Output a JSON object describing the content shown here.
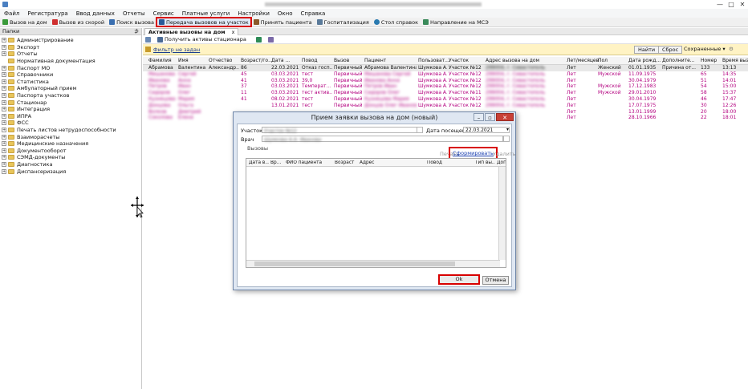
{
  "titlebar": {
    "controls": [
      "—",
      "□",
      "✕"
    ]
  },
  "menu": [
    "Файл",
    "Регистратура",
    "Ввод данных",
    "Отчеты",
    "Сервис",
    "Платные услуги",
    "Настройки",
    "Окно",
    "Справка"
  ],
  "toolbar": [
    {
      "label": "Вызов на дом",
      "icon": "house-call-icon",
      "color": "#3a9a3a"
    },
    {
      "label": "Вызов из скорой",
      "icon": "ambulance-icon",
      "color": "#d03030"
    },
    {
      "label": "Поиск вызова",
      "icon": "search-call-icon",
      "color": "#3a6fb0"
    },
    {
      "label": "Передача вызовов на участок",
      "icon": "transfer-icon",
      "color": "#2a5a9a"
    },
    {
      "label": "Принять пациента",
      "icon": "accept-patient-icon",
      "color": "#8a5a2a"
    },
    {
      "label": "Госпитализация",
      "icon": "hospital-icon",
      "color": "#5a7a9a"
    },
    {
      "label": "Стол справок",
      "icon": "help-desk-icon",
      "color": "#2a7ab0"
    },
    {
      "label": "Направление на МСЭ",
      "icon": "referral-icon",
      "color": "#3a8a5a"
    }
  ],
  "left_panel": {
    "title": "Папки",
    "pin": "⊅",
    "items": [
      {
        "label": "Администрирование",
        "expandable": true
      },
      {
        "label": "Экспорт",
        "expandable": true
      },
      {
        "label": "Отчеты",
        "expandable": true
      },
      {
        "label": "Нормативная документация",
        "expandable": false
      },
      {
        "label": "Паспорт МО",
        "expandable": true
      },
      {
        "label": "Справочники",
        "expandable": true
      },
      {
        "label": "Статистика",
        "expandable": true
      },
      {
        "label": "Амбулаторный прием",
        "expandable": true
      },
      {
        "label": "Паспорта участков",
        "expandable": true
      },
      {
        "label": "Стационар",
        "expandable": true
      },
      {
        "label": "Интеграция",
        "expandable": true
      },
      {
        "label": "ИПРА",
        "expandable": true
      },
      {
        "label": "ФСС",
        "expandable": true
      },
      {
        "label": "Печать листов нетрудоспособности",
        "expandable": true
      },
      {
        "label": "Взаиморасчеты",
        "expandable": true
      },
      {
        "label": "Медицинские назначения",
        "expandable": true
      },
      {
        "label": "Документооборот",
        "expandable": true
      },
      {
        "label": "СЭМД-документы",
        "expandable": true
      },
      {
        "label": "Диагностика",
        "expandable": true
      },
      {
        "label": "Диспансеризация",
        "expandable": true
      }
    ]
  },
  "main": {
    "tab": "Активные вызовы на дом",
    "tab_close": "x",
    "subtoolbar": {
      "get_assets": "Получить активы стационара"
    },
    "filter": {
      "text": "Фильтр не задан",
      "find": "Найти",
      "reset": "Сброс",
      "saved": "Сохраненные"
    },
    "columns": [
      "Фамилия",
      "Имя",
      "Отчество",
      "Возраст/го...",
      "Дата ...",
      "Повод",
      "Вызов",
      "Пациент",
      "Пользоват...",
      "Участок",
      "Адрес вызова на дом",
      "Лет/месяцев",
      "Пол",
      "Дата рожд...",
      "Дополните...",
      "Номер",
      "Время вызова"
    ],
    "rows": [
      {
        "fam": "Абрамова",
        "name": "Валентина",
        "otch": "Александр...",
        "age": "86",
        "date": "22.03.2021",
        "reason": "Отказ госп...",
        "call": "Первичный",
        "patient": "Абрамова Валентина",
        "user": "Шумкова А...",
        "uch": "Участок №12",
        "addr": "299004, г. Севастополь",
        "lm": "Лет",
        "sex": "Женский",
        "dob": "01.01.1935",
        "add": "Причина от...",
        "num": "133",
        "time": "13:13"
      },
      {
        "fam": "Мишанова",
        "name": "Сергей",
        "otch": "",
        "age": "45",
        "date": "03.03.2021",
        "reason": "тест",
        "call": "Первичный",
        "patient": "Мишанова Сергей",
        "user": "Шумкова А...",
        "uch": "Участок №12",
        "addr": "299004, г. Севастополь",
        "lm": "Лет",
        "sex": "Мужской",
        "dob": "11.09.1975",
        "add": "",
        "num": "65",
        "time": "14:35"
      },
      {
        "fam": "Иванова",
        "name": "Анна",
        "otch": "",
        "age": "41",
        "date": "03.03.2021",
        "reason": "39,0",
        "call": "Первичный",
        "patient": "Иванова Анна",
        "user": "Шумкова А...",
        "uch": "Участок №12",
        "addr": "299004, г. Севастополь",
        "lm": "Лет",
        "sex": "",
        "dob": "30.04.1979",
        "add": "",
        "num": "51",
        "time": "14:01"
      },
      {
        "fam": "Петров",
        "name": "Иван",
        "otch": "",
        "age": "37",
        "date": "03.03.2021",
        "reason": "Температ...",
        "call": "Первичный",
        "patient": "Петров Иван",
        "user": "Шумкова А...",
        "uch": "Участок №12",
        "addr": "299004, г. Севастополь",
        "lm": "Лет",
        "sex": "Мужской",
        "dob": "17.12.1983",
        "add": "",
        "num": "54",
        "time": "15:00"
      },
      {
        "fam": "Сидоров",
        "name": "Олег",
        "otch": "",
        "age": "11",
        "date": "03.03.2021",
        "reason": "тест актив...",
        "call": "Первичный",
        "patient": "Сидоров Олег",
        "user": "Шумкова А...",
        "uch": "Участок №11",
        "addr": "299004, г. Севастополь",
        "lm": "Лет",
        "sex": "Мужской",
        "dob": "29.01.2010",
        "add": "",
        "num": "58",
        "time": "15:37"
      },
      {
        "fam": "Кузнецова",
        "name": "Мария",
        "otch": "",
        "age": "41",
        "date": "08.02.2021",
        "reason": "тест",
        "call": "Первичный",
        "patient": "Кузнецова Мария",
        "user": "Шумкова А...",
        "uch": "Участок №12",
        "addr": "299004, г. Севастополь",
        "lm": "Лет",
        "sex": "",
        "dob": "30.04.1979",
        "add": "",
        "num": "46",
        "time": "17:47"
      },
      {
        "fam": "Донцова",
        "name": "Ольга",
        "otch": "",
        "age": "",
        "date": "13.01.2021",
        "reason": "тест",
        "call": "Первичный",
        "patient": "Донцов Олег Иванович",
        "user": "Шумкова А...",
        "uch": "Участок №12",
        "addr": "299004, г. Севастополь",
        "lm": "Лет",
        "sex": "",
        "dob": "17.07.1975",
        "add": "",
        "num": "30",
        "time": "12:26"
      },
      {
        "fam": "Волков",
        "name": "Дмитрий",
        "otch": "",
        "age": "",
        "date": "",
        "reason": "",
        "call": "",
        "patient": "",
        "user": "",
        "uch": "",
        "addr": "",
        "lm": "Лет",
        "sex": "",
        "dob": "13.01.1999",
        "add": "",
        "num": "20",
        "time": "18:00"
      },
      {
        "fam": "Соколова",
        "name": "Елена",
        "otch": "",
        "age": "",
        "date": "",
        "reason": "",
        "call": "",
        "patient": "",
        "user": "",
        "uch": "",
        "addr": "",
        "lm": "Лет",
        "sex": "",
        "dob": "28.10.1966",
        "add": "",
        "num": "22",
        "time": "18:01"
      }
    ]
  },
  "dialog": {
    "title": "Прием заявки вызова на дом (новый)",
    "uchastok_label": "Участок",
    "uchastok_value": "Участок №12",
    "date_label": "Дата посещения",
    "date_value": "22.03.2021",
    "doctor_label": "Врач",
    "doctor_value": "Шумкова А.А. Иванова",
    "calls_label": "Вызовы",
    "print": "Печать",
    "generate": "Сформировать",
    "delete": "Удалить",
    "columns": [
      "Дата в...",
      "Вр...",
      "ФИО пациента",
      "Возраст",
      "Адрес",
      "Повод",
      "Тип вы...",
      "Допол..."
    ],
    "ok": "Ok",
    "cancel": "Отмена"
  }
}
